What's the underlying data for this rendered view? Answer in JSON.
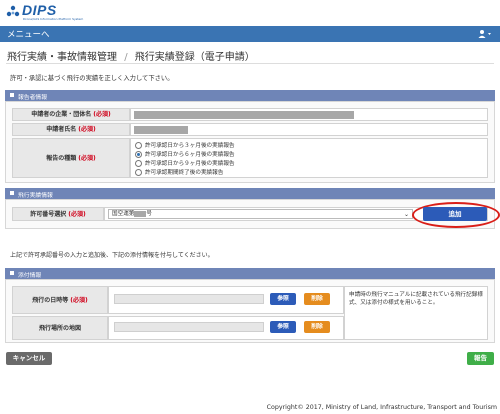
{
  "header": {
    "logo_text": "DIPS",
    "logo_subtext": "Drone/UAS Information Platform System",
    "menu_label": "メニューへ",
    "user_icon": "user-icon"
  },
  "page": {
    "breadcrumb_parent": "飛行実績・事故情報管理",
    "breadcrumb_sep": "/",
    "breadcrumb_current": "飛行実績登録（電子申請）",
    "instruction": "許可・承認に基づく飛行の実績を正しく入力して下さい。"
  },
  "reporter": {
    "section_title": "報告者情報",
    "company_label": "申請者の企業・団体名",
    "name_label": "申請者氏名",
    "report_type_label": "報告の種類",
    "required_mark": "(必須)",
    "report_types": [
      {
        "label": "許可承認日から３ヶ月後の実績報告",
        "selected": false
      },
      {
        "label": "許可承認日から６ヶ月後の実績報告",
        "selected": true
      },
      {
        "label": "許可承認日から９ヶ月後の実績報告",
        "selected": false
      },
      {
        "label": "許可承認期間終了後の実績報告",
        "selected": false
      }
    ]
  },
  "flight": {
    "section_title": "飛行実績情報",
    "permit_label": "許可番号選択",
    "required_mark": "(必須)",
    "permit_value": "国空運第",
    "permit_value_suffix": "号",
    "add_button": "追加",
    "note": "上記で許可承認番号の入力と追加後、下記の添付情報を付与してください。"
  },
  "attachments": {
    "section_title": "添付情報",
    "datetime_label": "飛行の日時等",
    "required_mark": "(必須)",
    "map_label": "飛行場所の地図",
    "browse_button": "参照",
    "delete_button": "削除",
    "side_note": "申請時の飛行マニュアルに記載されている飛行記録様式、又は添付の様式を用いること。"
  },
  "actions": {
    "cancel": "キャンセル",
    "report": "報告"
  },
  "footer": {
    "copyright": "Copyright© 2017, Ministry of Land, Infrastructure, Transport and Tourism"
  },
  "colors": {
    "menubar": "#3a74b3",
    "section_header": "#6f85b7",
    "required": "#d0021b",
    "primary_button": "#2c5bb8",
    "delete_button": "#e58c1e",
    "report_button": "#3fae48",
    "highlight_oval": "#d91e18"
  }
}
